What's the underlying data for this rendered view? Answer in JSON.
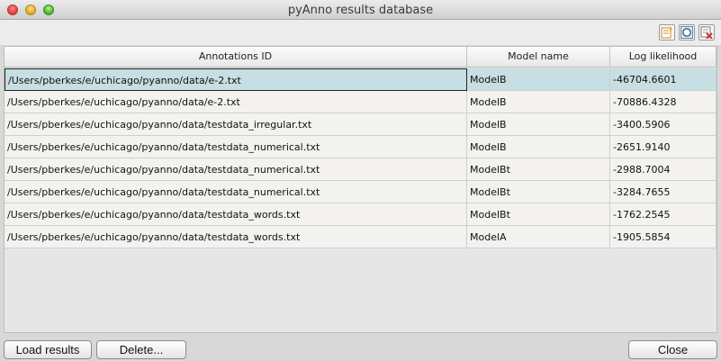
{
  "window": {
    "title": "pyAnno results database"
  },
  "table": {
    "columns": [
      "Annotations ID",
      "Model name",
      "Log likelihood"
    ],
    "rows": [
      {
        "annotations_id": "/Users/pberkes/e/uchicago/pyanno/data/e-2.txt",
        "model": "ModelB",
        "log_likelihood": "-46704.6601",
        "selected": true
      },
      {
        "annotations_id": "/Users/pberkes/e/uchicago/pyanno/data/e-2.txt",
        "model": "ModelB",
        "log_likelihood": "-70886.4328"
      },
      {
        "annotations_id": "/Users/pberkes/e/uchicago/pyanno/data/testdata_irregular.txt",
        "model": "ModelB",
        "log_likelihood": "-3400.5906"
      },
      {
        "annotations_id": "/Users/pberkes/e/uchicago/pyanno/data/testdata_numerical.txt",
        "model": "ModelB",
        "log_likelihood": "-2651.9140"
      },
      {
        "annotations_id": "/Users/pberkes/e/uchicago/pyanno/data/testdata_numerical.txt",
        "model": "ModelBt",
        "log_likelihood": "-2988.7004"
      },
      {
        "annotations_id": "/Users/pberkes/e/uchicago/pyanno/data/testdata_numerical.txt",
        "model": "ModelBt",
        "log_likelihood": "-3284.7655"
      },
      {
        "annotations_id": "/Users/pberkes/e/uchicago/pyanno/data/testdata_words.txt",
        "model": "ModelBt",
        "log_likelihood": "-1762.2545"
      },
      {
        "annotations_id": "/Users/pberkes/e/uchicago/pyanno/data/testdata_words.txt",
        "model": "ModelA",
        "log_likelihood": "-1905.5854"
      }
    ]
  },
  "toolbar": {
    "icons": [
      "add-row-icon",
      "zoom-icon",
      "delete-row-icon"
    ]
  },
  "buttons": {
    "load": "Load results",
    "delete": "Delete...",
    "close": "Close"
  },
  "colors": {
    "selection": "#c7dee2",
    "row_bg": "#f3f2ef"
  }
}
